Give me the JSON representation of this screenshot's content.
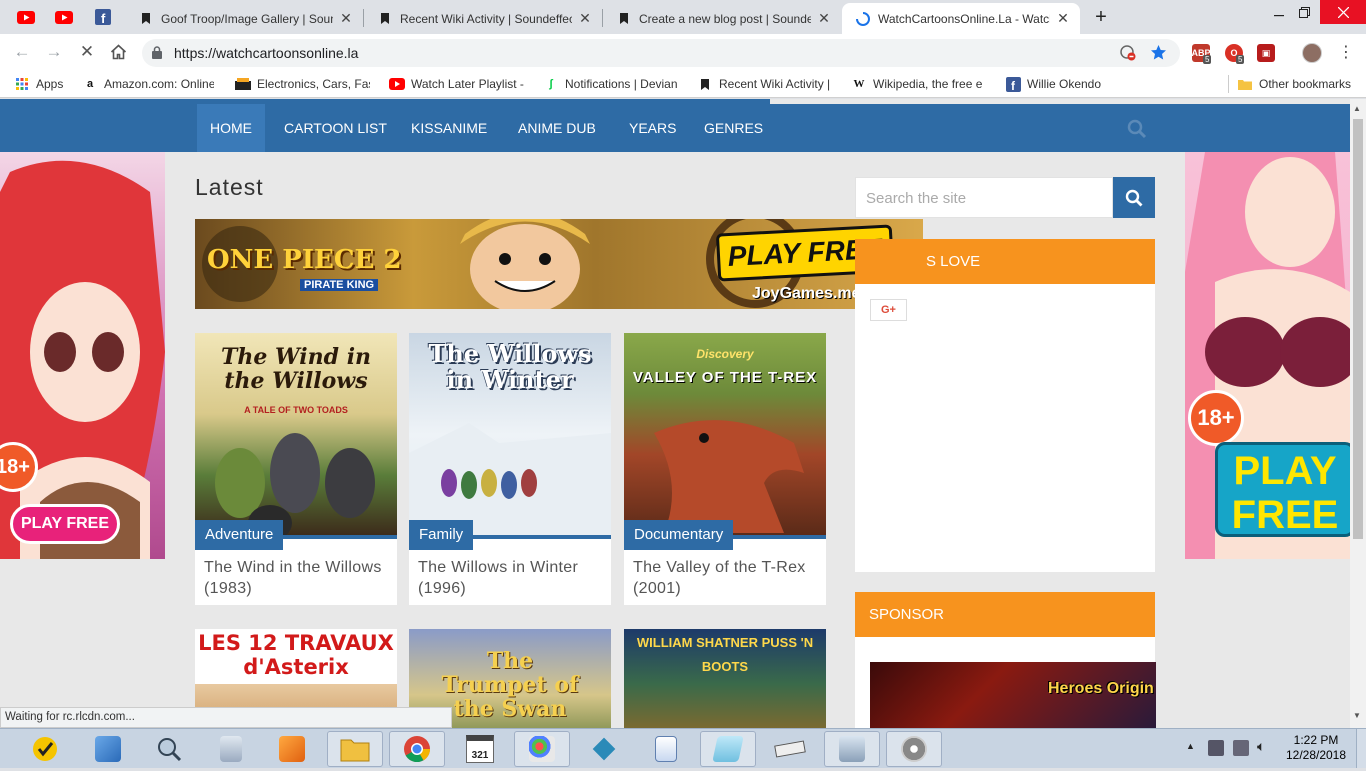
{
  "browser": {
    "tabs": [
      {
        "title": "Goof Troop/Image Gallery | Soun",
        "active": false
      },
      {
        "title": "Recent Wiki Activity | Soundeffec",
        "active": false
      },
      {
        "title": "Create a new blog post | Sounde",
        "active": false
      },
      {
        "title": "WatchCartoonsOnline.La - Watch",
        "active": true
      }
    ],
    "new_tab": "+",
    "url": "https://watchcartoonsonline.la",
    "bookmarks": [
      {
        "label": "Apps",
        "icon": "apps-grid-icon"
      },
      {
        "label": "Amazon.com: Online",
        "icon": "amazon-icon"
      },
      {
        "label": "Electronics, Cars, Fasl",
        "icon": "ebay-icon"
      },
      {
        "label": "Watch Later Playlist -",
        "icon": "youtube-icon"
      },
      {
        "label": "Notifications | Devian",
        "icon": "deviantart-icon"
      },
      {
        "label": "Recent Wiki Activity |",
        "icon": "wiki-icon"
      },
      {
        "label": "Wikipedia, the free e",
        "icon": "wikipedia-icon"
      },
      {
        "label": "Willie Okendo",
        "icon": "facebook-icon"
      }
    ],
    "other_bookmarks": "Other bookmarks",
    "ext_badges": [
      "5",
      "5"
    ],
    "status": "Waiting for rc.rlcdn.com..."
  },
  "site": {
    "nav": [
      "HOME",
      "CARTOON LIST",
      "KISSANIME",
      "ANIME DUB",
      "YEARS",
      "GENRES"
    ],
    "page_title": "Latest",
    "search_placeholder": "Search the site",
    "banner": {
      "game": "ONE PIECE 2",
      "sub": "PIRATE KING",
      "cta": "PLAY FREE",
      "domain": "JoyGames.me"
    },
    "cards": [
      {
        "category": "Adventure",
        "title": "The Wind in the Willows (1983)",
        "poster_text": "The Wind in the Willows",
        "poster_sub": "A TALE OF TWO TOADS"
      },
      {
        "category": "Family",
        "title": "The Willows in Winter (1996)",
        "poster_text": "The Willows in Winter",
        "poster_sub": ""
      },
      {
        "category": "Documentary",
        "title": "The Valley of the T-Rex (2001)",
        "poster_text": "VALLEY OF THE T-REX",
        "poster_sub": "Discovery"
      }
    ],
    "row2_posters": [
      {
        "text": "LES 12 TRAVAUX d'Asterix"
      },
      {
        "text": "The Trumpet of the Swan"
      },
      {
        "text": "WILLIAM SHATNER  PUSS 'N BOOTS"
      }
    ],
    "widget_love": "S LOVE",
    "gplus": "G+",
    "widget_sponsor": "SPONSOR",
    "sponsor_ad": "Heroes Origin",
    "side_ad": {
      "badge": "18+",
      "cta": "PLAY FREE",
      "cta_right": "PLAY FREE"
    }
  },
  "taskbar": {
    "time": "1:22 PM",
    "date": "12/28/2018",
    "calendar_day": "321"
  },
  "colors": {
    "nav": "#2e6ba5",
    "orange": "#f7931e",
    "cta_pink": "#e8227a"
  }
}
